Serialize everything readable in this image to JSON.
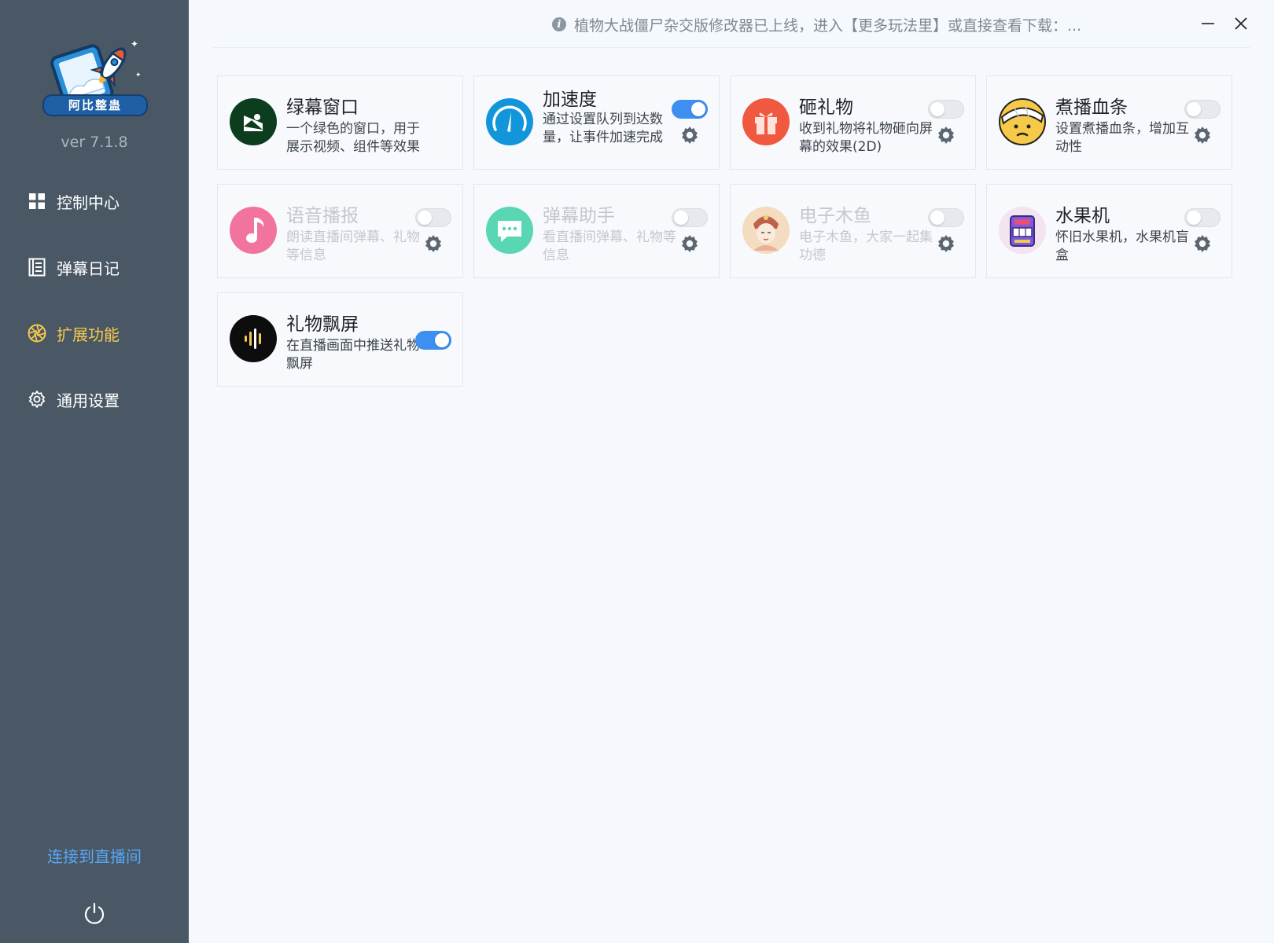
{
  "app": {
    "logo_text": "阿比整蛊",
    "version": "ver 7.1.8"
  },
  "sidebar": {
    "items": [
      {
        "label": "控制中心",
        "icon": "grid-icon"
      },
      {
        "label": "弹幕日记",
        "icon": "document-list-icon"
      },
      {
        "label": "扩展功能",
        "icon": "aperture-icon",
        "active": true
      },
      {
        "label": "通用设置",
        "icon": "gear-icon"
      }
    ],
    "connect_label": "连接到直播间",
    "power_icon": "power-icon"
  },
  "topbar": {
    "notice": "植物大战僵尸杂交版修改器已上线，进入【更多玩法里】或直接查看下载：...",
    "minimize_icon": "minimize-icon",
    "close_icon": "close-icon"
  },
  "cards": [
    {
      "title": "绿幕窗口",
      "desc": "一个绿色的窗口，用于展示视频、组件等效果",
      "icon": "greenscreen-icon",
      "icon_color": "#0b3d1e"
    },
    {
      "title": "加速度",
      "desc": "通过设置队列到达数量，让事件加速完成",
      "icon": "speedometer-icon",
      "icon_color": "#1296db",
      "toggle": true
    },
    {
      "title": "砸礼物",
      "desc": "收到礼物将礼物砸向屏幕的效果(2D)",
      "icon": "gift-icon",
      "icon_color": "#f0593f",
      "toggle": false
    },
    {
      "title": "煮播血条",
      "desc": "设置煮播血条，增加互动性",
      "icon": "bandaged-face-icon",
      "icon_color": "#f7c948",
      "toggle": false
    },
    {
      "title": "语音播报",
      "desc": "朗读直播间弹幕、礼物等信息",
      "icon": "music-note-icon",
      "icon_color": "#f25c8e",
      "toggle": false,
      "disabled": true
    },
    {
      "title": "弹幕助手",
      "desc": "看直播间弹幕、礼物等信息",
      "icon": "chat-bubble-icon",
      "icon_color": "#3ed0a8",
      "toggle": false,
      "disabled": true
    },
    {
      "title": "电子木鱼",
      "desc": "电子木鱼，大家一起集功德",
      "icon": "monk-avatar-icon",
      "icon_color": "#f3d7b5",
      "toggle": false,
      "disabled": true
    },
    {
      "title": "水果机",
      "desc": "怀旧水果机，水果机盲盒",
      "icon": "slot-machine-icon",
      "icon_color": "#7a5be0",
      "toggle": false
    },
    {
      "title": "礼物飘屏",
      "desc": "在直播画面中推送礼物飘屏",
      "icon": "sound-wave-icon",
      "icon_color": "#0d0d0d",
      "toggle": true
    }
  ]
}
